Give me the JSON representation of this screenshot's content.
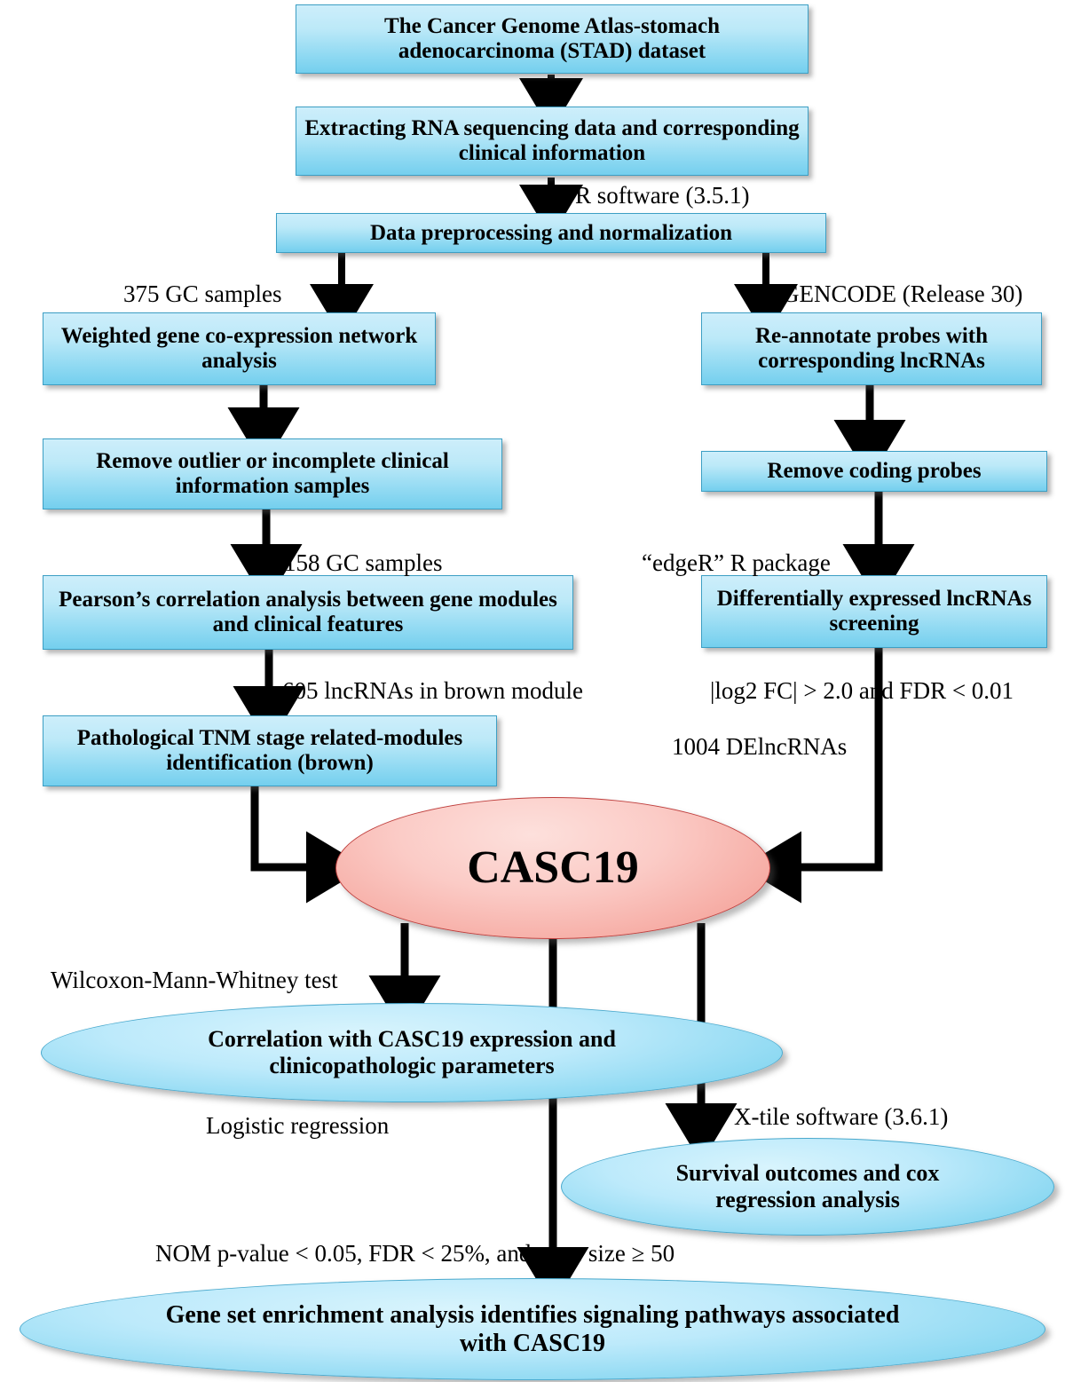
{
  "diagram": {
    "title": "CASC19 lncRNA study workflow flowchart",
    "colors": {
      "box_fill": "#9fdff4",
      "box_border": "#3d9fc4",
      "ellipse_blue_fill": "#8ed9f2",
      "ellipse_pink_fill": "#f6aba3",
      "ellipse_pink_border": "#c0413f",
      "connector": "#000000"
    },
    "nodes": [
      {
        "id": "tcga-dataset",
        "shape": "box",
        "text": "The Cancer Genome Atlas-stomach adenocarcinoma (STAD) dataset"
      },
      {
        "id": "extract-rna",
        "shape": "box",
        "text": "Extracting RNA sequencing data and corresponding clinical information"
      },
      {
        "id": "preprocess",
        "shape": "box",
        "text": "Data preprocessing and normalization"
      },
      {
        "id": "wgcna",
        "shape": "box",
        "text": "Weighted gene co-expression network analysis"
      },
      {
        "id": "reannotate",
        "shape": "box",
        "text": "Re-annotate probes with corresponding lncRNAs"
      },
      {
        "id": "remove-outlier",
        "shape": "box",
        "text": "Remove outlier or incomplete clinical information samples"
      },
      {
        "id": "remove-coding",
        "shape": "box",
        "text": "Remove coding probes"
      },
      {
        "id": "pearson",
        "shape": "box",
        "text": "Pearson’s correlation analysis between gene modules and clinical  features"
      },
      {
        "id": "de-lncrna",
        "shape": "box",
        "text": "Differentially expressed lncRNAs screening"
      },
      {
        "id": "tnm-modules",
        "shape": "box",
        "text": "Pathological TNM stage related-modules identification (brown)"
      },
      {
        "id": "casc19",
        "shape": "ellipse-pink",
        "text": "CASC19"
      },
      {
        "id": "correlation",
        "shape": "ellipse-blue",
        "text": "Correlation with CASC19 expression and clinicopathologic parameters"
      },
      {
        "id": "survival",
        "shape": "ellipse-blue",
        "text": "Survival outcomes and cox regression analysis"
      },
      {
        "id": "gsea",
        "shape": "ellipse-blue",
        "text": "Gene set enrichment analysis identifies signaling pathways associated with CASC19"
      }
    ],
    "edge_labels": [
      {
        "id": "r-software",
        "text": "R software (3.5.1)"
      },
      {
        "id": "gc-samples-375",
        "text": "375 GC samples"
      },
      {
        "id": "gencode",
        "text": "GENCODE (Release 30)"
      },
      {
        "id": "gc-samples-158",
        "text": "158 GC samples"
      },
      {
        "id": "edger",
        "text": "“edgeR” R package"
      },
      {
        "id": "lncrnas-brown",
        "text": "605 lncRNAs in brown module"
      },
      {
        "id": "log2fc",
        "text": "|log2 FC| > 2.0 and FDR < 0.01"
      },
      {
        "id": "delncrnas",
        "text": "1004 DElncRNAs"
      },
      {
        "id": "wilcoxon",
        "text": "Wilcoxon-Mann-Whitney test"
      },
      {
        "id": "logistic",
        "text": "Logistic regression"
      },
      {
        "id": "xtile",
        "text": "X-tile software (3.6.1)"
      },
      {
        "id": "gsea-criteria",
        "text": "NOM p-value < 0.05, FDR < 25%, and gene size ≥ 50"
      }
    ]
  }
}
